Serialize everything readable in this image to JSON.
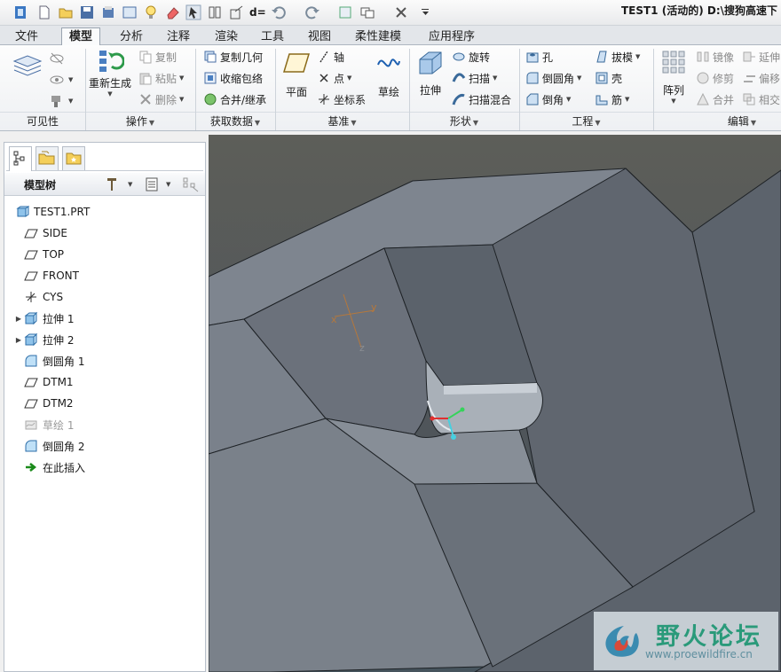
{
  "app_title": "TEST1 (活动的) D:\\搜狗高速下",
  "tabs": [
    "文件",
    "模型",
    "分析",
    "注释",
    "渲染",
    "工具",
    "视图",
    "柔性建模",
    "应用程序"
  ],
  "ribbon": {
    "groups": {
      "visibility": "可见性",
      "operations": "操作",
      "get_data": "获取数据",
      "datum": "基准",
      "shapes": "形状",
      "engineering": "工程",
      "editing": "编辑"
    },
    "operations": {
      "regenerate": "重新生成",
      "copy": "复制",
      "paste": "粘贴",
      "delete": "删除"
    },
    "get_data": {
      "copy_geometry": "复制几何",
      "shrinkwrap": "收缩包络",
      "merge_inherit": "合并/继承"
    },
    "datum": {
      "plane": "平面",
      "axis": "轴",
      "point": "点",
      "csys": "坐标系",
      "sketch": "草绘"
    },
    "shapes": {
      "extrude": "拉伸",
      "revolve": "旋转",
      "sweep": "扫描",
      "swept_blend": "扫描混合"
    },
    "engineering": {
      "hole": "孔",
      "round": "倒圆角",
      "chamfer": "倒角",
      "draft": "拔模",
      "shell": "壳",
      "rib": "筋"
    },
    "editing": {
      "pattern": "阵列",
      "mirror": "镜像",
      "trim": "修剪",
      "merge": "合并",
      "extend": "延伸",
      "offset": "偏移",
      "intersect": "相交"
    }
  },
  "model_tree": {
    "title": "模型树",
    "items": [
      {
        "label": "TEST1.PRT",
        "icon": "part-icon",
        "expandable": false,
        "muted": false
      },
      {
        "label": "SIDE",
        "icon": "datum-plane-icon",
        "expandable": false,
        "muted": false
      },
      {
        "label": "TOP",
        "icon": "datum-plane-icon",
        "expandable": false,
        "muted": false
      },
      {
        "label": "FRONT",
        "icon": "datum-plane-icon",
        "expandable": false,
        "muted": false
      },
      {
        "label": "CYS",
        "icon": "csys-icon",
        "expandable": false,
        "muted": false
      },
      {
        "label": "拉伸 1",
        "icon": "extrude-icon",
        "expandable": true,
        "muted": false
      },
      {
        "label": "拉伸 2",
        "icon": "extrude-icon",
        "expandable": true,
        "muted": false
      },
      {
        "label": "倒圆角 1",
        "icon": "round-icon",
        "expandable": false,
        "muted": false
      },
      {
        "label": "DTM1",
        "icon": "datum-plane-icon",
        "expandable": false,
        "muted": false
      },
      {
        "label": "DTM2",
        "icon": "datum-plane-icon",
        "expandable": false,
        "muted": false
      },
      {
        "label": "草绘 1",
        "icon": "sketch-icon",
        "expandable": false,
        "muted": true
      },
      {
        "label": "倒圆角 2",
        "icon": "round-icon",
        "expandable": false,
        "muted": false
      },
      {
        "label": "在此插入",
        "icon": "insert-here-icon",
        "expandable": false,
        "muted": false
      }
    ]
  },
  "viewport": {
    "csys_labels": {
      "x": "x",
      "y": "y",
      "z": "z"
    }
  },
  "watermark": {
    "title": "野火论坛",
    "url": "www.proewildfire.cn"
  }
}
